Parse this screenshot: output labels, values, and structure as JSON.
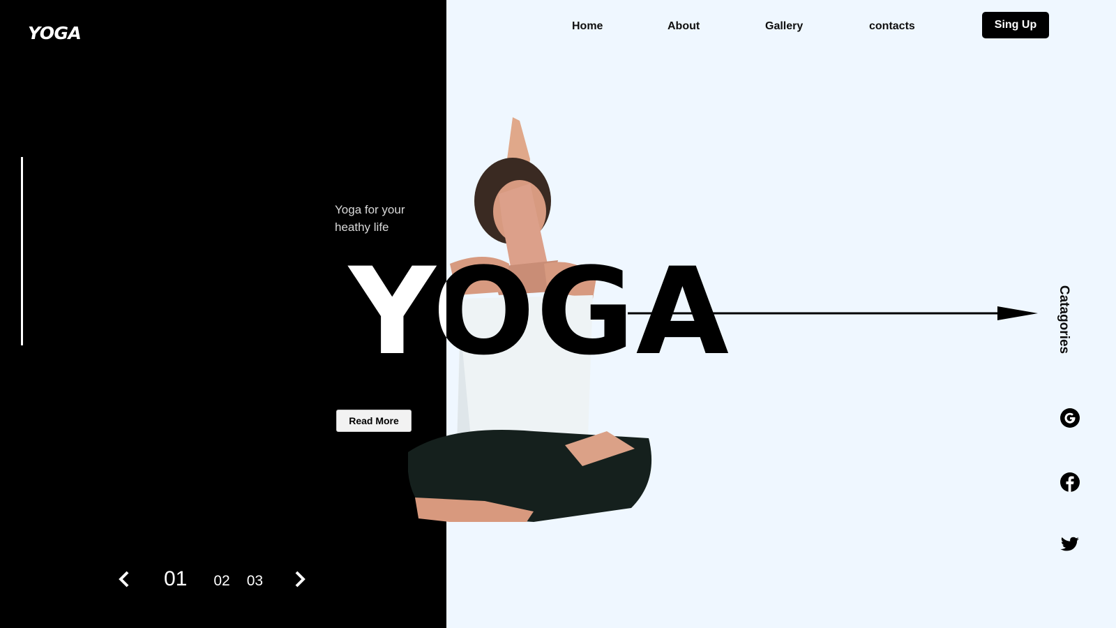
{
  "brand": {
    "logo": "YOGA"
  },
  "nav": {
    "items": [
      "Home",
      "About",
      "Gallery",
      "contacts"
    ],
    "signup_label": "Sing Up"
  },
  "hero": {
    "tagline": "Yoga for your heathy life",
    "title": "YOGA",
    "read_more_label": "Read More"
  },
  "slider": {
    "current": "01",
    "pages": [
      "02",
      "03"
    ]
  },
  "side": {
    "categories_label": "Catagories"
  },
  "social": {
    "icons": [
      "google-icon",
      "facebook-icon",
      "twitter-icon"
    ]
  },
  "colors": {
    "dark_panel": "#000000",
    "light_bg": "#eff7ff",
    "accent": "#000000"
  }
}
